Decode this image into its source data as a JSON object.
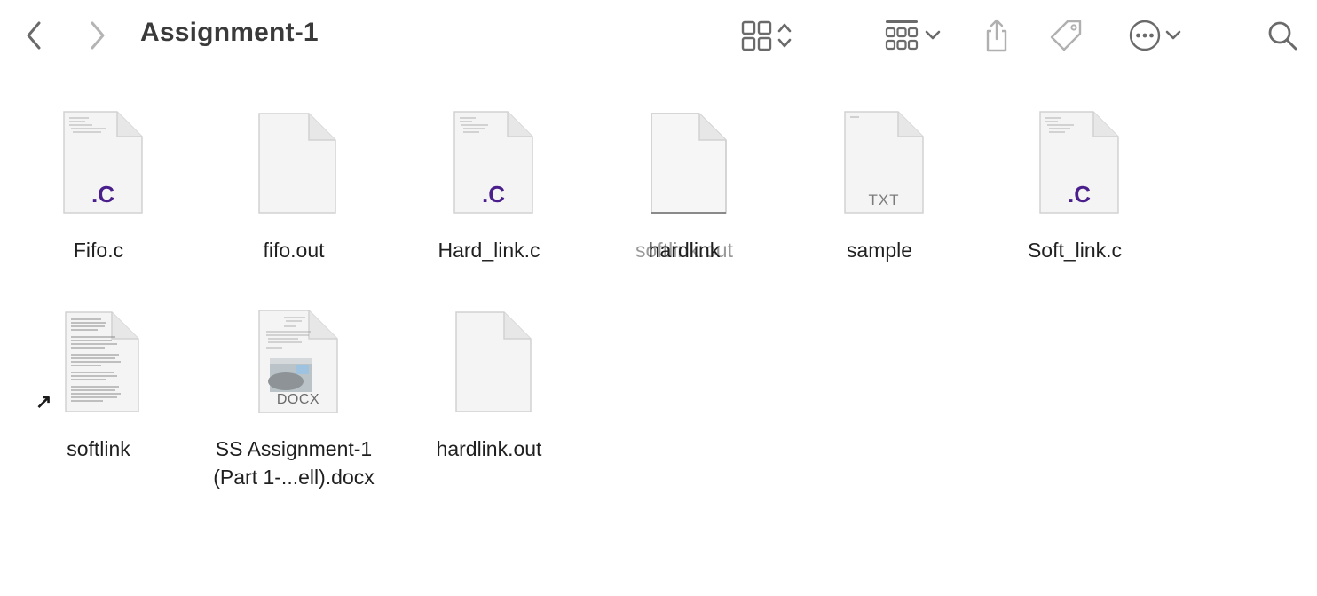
{
  "window": {
    "title": "Assignment-1"
  },
  "toolbar": {
    "back_icon": "chevron-left-icon",
    "forward_icon": "chevron-right-icon",
    "view_icon": "grid-view-icon",
    "view_sort_icon": "up-down-chevron-icon",
    "group_icon": "group-grid-icon",
    "group_chevron_icon": "chevron-down-icon",
    "share_icon": "share-icon",
    "tag_icon": "tag-icon",
    "more_icon": "ellipsis-circle-icon",
    "more_chevron_icon": "chevron-down-icon",
    "search_icon": "search-icon"
  },
  "files": [
    {
      "name": "Fifo.c",
      "badge": ".C",
      "kind": "c-source"
    },
    {
      "name": "fifo.out",
      "badge": "",
      "kind": "executable"
    },
    {
      "name": "Hard_link.c",
      "badge": ".C",
      "kind": "c-source"
    },
    {
      "name_front": "hardlink",
      "name_back": "softlink.out",
      "badge": "",
      "kind": "executable"
    },
    {
      "name": "sample",
      "badge": "TXT",
      "kind": "text"
    },
    {
      "name": "Soft_link.c",
      "badge": ".C",
      "kind": "c-source"
    },
    {
      "name": "softlink",
      "badge": "",
      "kind": "alias",
      "alias_glyph": "↗"
    },
    {
      "name_line1": "SS Assignment-1",
      "name_line2": "(Part 1-...ell).docx",
      "badge": "DOCX",
      "kind": "document"
    },
    {
      "name": "hardlink.out",
      "badge": "",
      "kind": "executable"
    }
  ],
  "colors": {
    "c_badge": "#4a1f8c",
    "icon_gray": "#7a7a7a"
  }
}
